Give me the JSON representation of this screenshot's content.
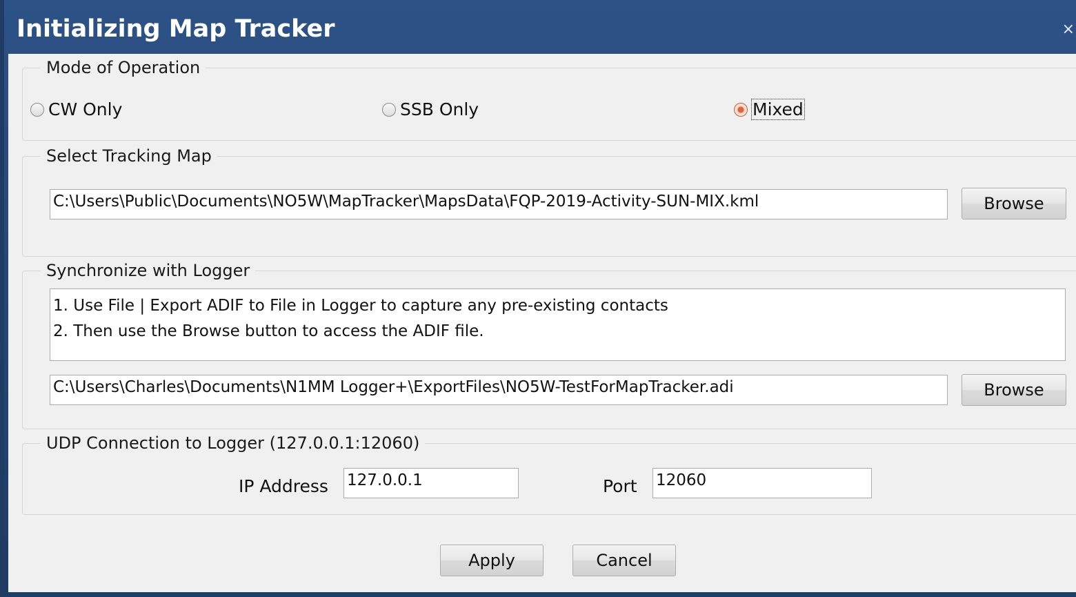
{
  "window": {
    "title": "Initializing Map Tracker",
    "close_glyph": "×"
  },
  "mode_group": {
    "legend": "Mode of Operation",
    "options": [
      {
        "label": "CW Only",
        "checked": false
      },
      {
        "label": "SSB Only",
        "checked": false
      },
      {
        "label": "Mixed",
        "checked": true
      }
    ]
  },
  "map_group": {
    "legend": "Select Tracking Map",
    "path": "C:\\Users\\Public\\Documents\\NO5W\\MapTracker\\MapsData\\FQP-2019-Activity-SUN-MIX.kml",
    "browse_label": "Browse"
  },
  "sync_group": {
    "legend": "Synchronize with Logger",
    "instructions": [
      "1. Use File | Export ADIF to File in Logger to capture any pre-existing contacts",
      "2. Then use the Browse button to access the ADIF file."
    ],
    "path": "C:\\Users\\Charles\\Documents\\N1MM Logger+\\ExportFiles\\NO5W-TestForMapTracker.adi",
    "browse_label": "Browse"
  },
  "udp_group": {
    "legend": "UDP Connection to Logger  (127.0.0.1:12060)",
    "ip_label": "IP Address",
    "ip_value": "127.0.0.1",
    "port_label": "Port",
    "port_value": "12060"
  },
  "footer": {
    "apply_label": "Apply",
    "cancel_label": "Cancel"
  },
  "colors": {
    "title_bar": "#2d5286",
    "client_bg": "#f0f0f0",
    "radio_checked": "#e0633a"
  }
}
